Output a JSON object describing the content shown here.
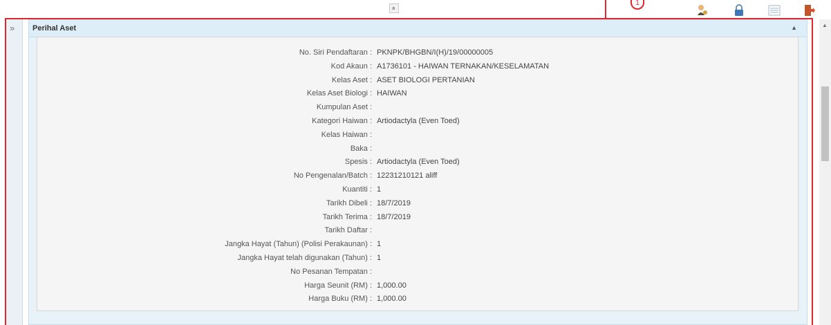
{
  "toolbar": {
    "collapse_glyph": "«",
    "callout_number": "1",
    "icons": [
      "user-icon",
      "lock-icon",
      "list-icon",
      "logout-icon"
    ]
  },
  "sidebar": {
    "expand_glyph": "»"
  },
  "panel": {
    "title": "Perihal Aset",
    "collapse_caret": "▲"
  },
  "fields": [
    {
      "label": "No. Siri Pendaftaran :",
      "value": "PKNPK/BHGBN/I(H)/19/00000005"
    },
    {
      "label": "Kod Akaun :",
      "value": "A1736101 - HAIWAN TERNAKAN/KESELAMATAN"
    },
    {
      "label": "Kelas Aset :",
      "value": "ASET BIOLOGI PERTANIAN"
    },
    {
      "label": "Kelas Aset Biologi :",
      "value": "HAIWAN"
    },
    {
      "label": "Kumpulan Aset :",
      "value": ""
    },
    {
      "label": "Kategori Haiwan :",
      "value": "Artiodactyla (Even Toed)"
    },
    {
      "label": "Kelas Haiwan :",
      "value": ""
    },
    {
      "label": "Baka :",
      "value": ""
    },
    {
      "label": "Spesis :",
      "value": "Artiodactyla (Even Toed)"
    },
    {
      "label": "No Pengenalan/Batch :",
      "value": "12231210121 aliff"
    },
    {
      "label": "Kuantiti :",
      "value": "1"
    },
    {
      "label": "Tarikh Dibeli :",
      "value": "18/7/2019"
    },
    {
      "label": "Tarikh Terima :",
      "value": "18/7/2019"
    },
    {
      "label": "Tarikh Daftar :",
      "value": ""
    },
    {
      "label": "Jangka Hayat (Tahun) (Polisi Perakaunan) :",
      "value": "1"
    },
    {
      "label": "Jangka Hayat telah digunakan (Tahun) :",
      "value": "1"
    },
    {
      "label": "No Pesanan Tempatan :",
      "value": ""
    },
    {
      "label": "Harga Seunit (RM) :",
      "value": "1,000.00"
    },
    {
      "label": "Harga Buku (RM) :",
      "value": "1,000.00"
    }
  ],
  "colors": {
    "highlight": "#e0262d",
    "panel_header": "#ddeef8",
    "panel_body": "#f5f5f5"
  }
}
